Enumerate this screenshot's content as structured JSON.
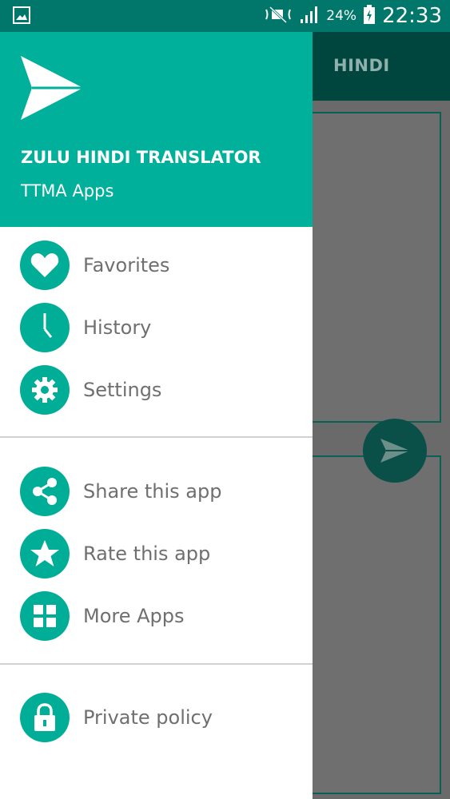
{
  "status_bar": {
    "battery_percent": "24%",
    "time": "22:33",
    "icons": [
      "gallery-icon",
      "mute-icon",
      "signal-icon",
      "battery-charging-icon"
    ]
  },
  "background_app": {
    "tab_label": "HINDI"
  },
  "drawer": {
    "header": {
      "title": "ZULU HINDI TRANSLATOR",
      "subtitle": "TTMA Apps",
      "logo_icon": "paper-plane-icon"
    },
    "sections": [
      {
        "items": [
          {
            "label": "Favorites",
            "icon": "heart-icon"
          },
          {
            "label": "History",
            "icon": "clock-icon"
          },
          {
            "label": "Settings",
            "icon": "gear-icon"
          }
        ]
      },
      {
        "items": [
          {
            "label": "Share this app",
            "icon": "share-icon"
          },
          {
            "label": "Rate this app",
            "icon": "star-icon"
          },
          {
            "label": "More Apps",
            "icon": "grid-icon"
          }
        ]
      },
      {
        "items": [
          {
            "label": "Private policy",
            "icon": "lock-icon"
          }
        ]
      }
    ]
  },
  "colors": {
    "header": "#00b09a",
    "icon_circle": "#00ad97",
    "status_bar": "#00776a",
    "menu_text": "#6f6f6f"
  }
}
